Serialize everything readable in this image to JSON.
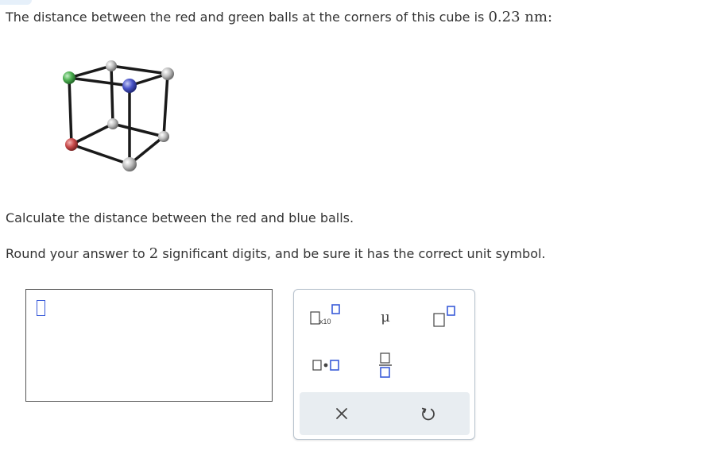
{
  "question": {
    "line1_text": "The distance between the red and green balls at the corners of this cube is ",
    "line1_value": "0.23",
    "line1_unit": "nm",
    "line1_end": ":",
    "line2_text": "Calculate the distance between the red and blue balls.",
    "line3_text_a": "Round your answer to ",
    "line3_value": "2",
    "line3_text_b": " significant digits, and be sure it has the correct unit symbol."
  },
  "cube": {
    "balls": [
      "green",
      "gray",
      "gray",
      "blue",
      "gray",
      "red",
      "gray",
      "gray"
    ],
    "colors": {
      "red": "#c84a4a",
      "green": "#4caf50",
      "blue": "#4a55c8",
      "gray": "#b5b5b5"
    }
  },
  "palette": {
    "x10_label": "x10",
    "mu_label": "μ",
    "buttons": [
      "scientific-notation",
      "micro-prefix",
      "superscript",
      "multiply-dot",
      "fraction",
      "clear",
      "undo"
    ]
  },
  "colors": {
    "accent": "#3a5bd9",
    "palette_footer": "#e8edf1",
    "text": "#333333"
  }
}
